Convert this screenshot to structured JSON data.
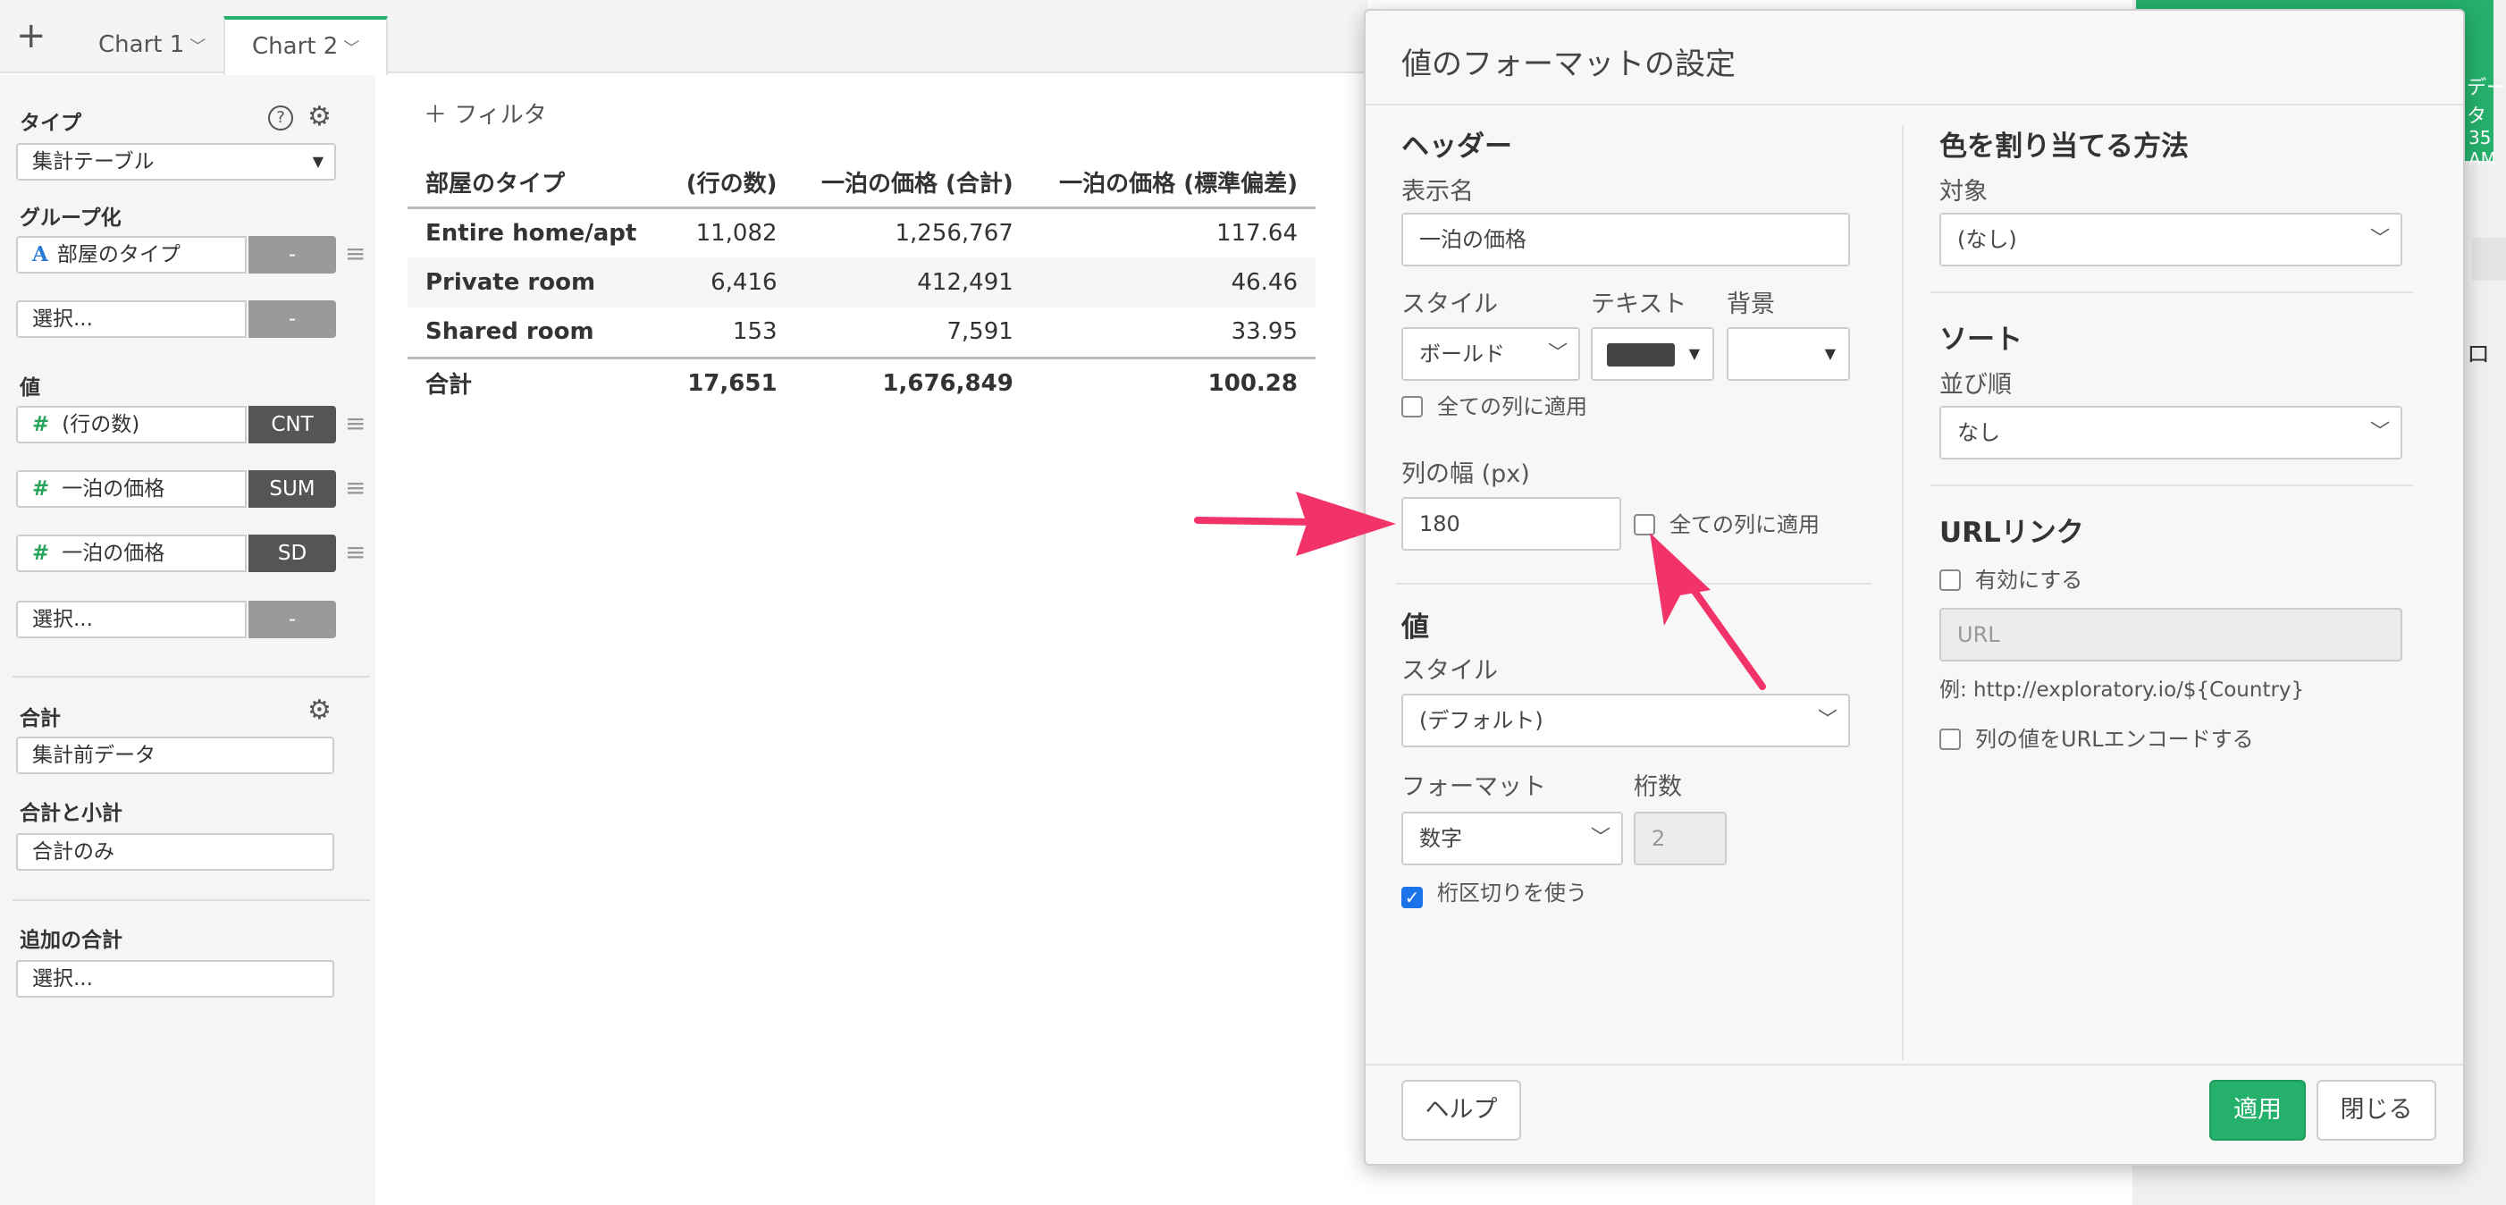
{
  "tabs": {
    "add": "+",
    "items": [
      "Chart 1",
      "Chart 2"
    ]
  },
  "left": {
    "type_label": "タイプ",
    "type_value": "集計テーブル",
    "group_label": "グループ化",
    "group_field": "部屋のタイプ",
    "group_agg": "-",
    "group_select": "選択...",
    "group_select_agg": "-",
    "value_label": "値",
    "values": [
      {
        "name": "(行の数)",
        "agg": "CNT"
      },
      {
        "name": "一泊の価格",
        "agg": "SUM"
      },
      {
        "name": "一泊の価格",
        "agg": "SD"
      }
    ],
    "value_select": "選択...",
    "value_select_agg": "-",
    "total_label": "合計",
    "total_value": "集計前データ",
    "subtotal_label": "合計と小計",
    "subtotal_value": "合計のみ",
    "extra_label": "追加の合計",
    "extra_value": "選択..."
  },
  "main": {
    "filter": "フィルタ",
    "columns": [
      "部屋のタイプ",
      "(行の数)",
      "一泊の価格 (合計)",
      "一泊の価格 (標準偏差)"
    ],
    "rows": [
      [
        "Entire home/apt",
        "11,082",
        "1,256,767",
        "117.64"
      ],
      [
        "Private room",
        "6,416",
        "412,491",
        "46.46"
      ],
      [
        "Shared room",
        "153",
        "7,591",
        "33.95"
      ]
    ],
    "total": [
      "合計",
      "17,651",
      "1,676,849",
      "100.28"
    ]
  },
  "bg_right": {
    "t1": "データ",
    "t2": "35 AM",
    "t3": "ロ"
  },
  "modal": {
    "title": "値のフォーマットの設定",
    "header_section": "ヘッダー",
    "display_name_label": "表示名",
    "display_name_value": "一泊の価格",
    "style_label": "スタイル",
    "text_label": "テキスト",
    "bg_label": "背景",
    "style_value": "ボールド",
    "text_color": "#444444",
    "apply_all_1": "全ての列に適用",
    "width_label": "列の幅 (px)",
    "width_value": "180",
    "apply_all_2": "全ての列に適用",
    "value_section": "値",
    "value_style_label": "スタイル",
    "value_style_value": "(デフォルト)",
    "format_label": "フォーマット",
    "digits_label": "桁数",
    "format_value": "数字",
    "digits_placeholder": "2",
    "separator_label": "桁区切りを使う",
    "color_section": "色を割り当てる方法",
    "target_label": "対象",
    "target_value": "(なし)",
    "sort_section": "ソート",
    "order_label": "並び順",
    "order_value": "なし",
    "url_section": "URLリンク",
    "enable_label": "有効にする",
    "url_placeholder": "URL",
    "url_example": "例: http://exploratory.io/${Country}",
    "encode_label": "列の値をURLエンコードする",
    "help_button": "ヘルプ",
    "apply_button": "適用",
    "close_button": "閉じる"
  }
}
